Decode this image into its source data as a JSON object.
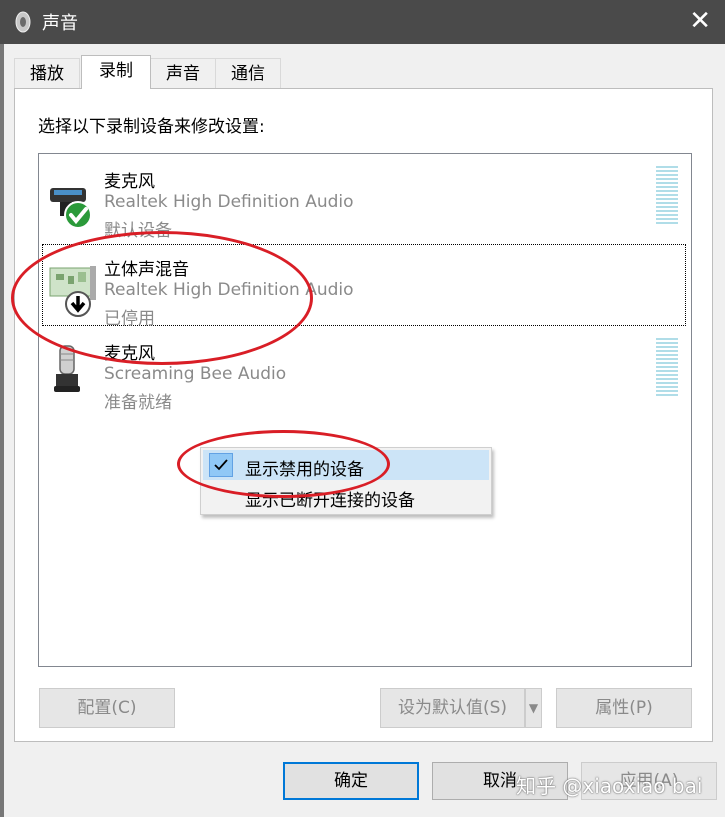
{
  "window": {
    "title": "声音"
  },
  "tabs": [
    {
      "label": "播放"
    },
    {
      "label": "录制"
    },
    {
      "label": "声音"
    },
    {
      "label": "通信"
    }
  ],
  "recording": {
    "instruction": "选择以下录制设备来修改设置:",
    "devices": [
      {
        "name": "麦克风",
        "driver": "Realtek High Definition Audio",
        "status": "默认设备",
        "icon": "microphone-default-icon"
      },
      {
        "name": "立体声混音",
        "driver": "Realtek High Definition Audio",
        "status": "已停用",
        "icon": "stereo-mix-disabled-icon"
      },
      {
        "name": "麦克风",
        "driver": "Screaming Bee Audio",
        "status": "准备就绪",
        "icon": "microphone-icon"
      }
    ]
  },
  "context_menu": {
    "items": [
      {
        "label": "显示禁用的设备",
        "checked": true
      },
      {
        "label": "显示已断开连接的设备",
        "checked": false
      }
    ]
  },
  "buttons": {
    "configure": "配置(C)",
    "set_default": "设为默认值(S)",
    "properties": "属性(P)",
    "ok": "确定",
    "cancel": "取消",
    "apply": "应用(A)"
  },
  "watermark": "知乎 @xiaoxiao bai",
  "colors": {
    "titlebar": "#4a4a4a",
    "annotation": "#d91e26",
    "selection": "#cce4f7",
    "primary_border": "#0078d7"
  }
}
